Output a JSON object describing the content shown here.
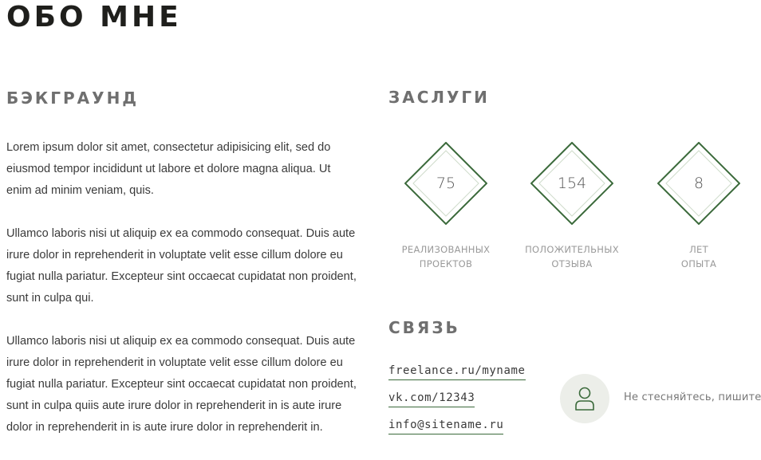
{
  "page": {
    "title": "ОБО МНЕ"
  },
  "background": {
    "title": "БЭКГРАУНД",
    "paragraphs": [
      "Lorem ipsum dolor sit amet, consectetur adipisicing elit, sed do eiusmod tempor incididunt ut labore et dolore magna aliqua. Ut enim ad minim veniam, quis.",
      "Ullamco laboris nisi ut aliquip ex ea commodo consequat. Duis aute irure dolor in reprehenderit in voluptate velit esse cillum dolore eu fugiat nulla pariatur. Excepteur sint occaecat cupidatat non proident, sunt in culpa qui.",
      "Ullamco laboris nisi ut aliquip ex ea commodo consequat. Duis aute irure dolor in reprehenderit in voluptate velit esse cillum dolore eu fugiat nulla pariatur. Excepteur sint occaecat cupidatat non proident, sunt in culpa quiis aute irure dolor in reprehenderit in is aute irure dolor in reprehenderit in is aute irure dolor in reprehenderit in."
    ]
  },
  "merits": {
    "title": "ЗАСЛУГИ",
    "stats": [
      {
        "value": "75",
        "label_line1": "РЕАЛИЗОВАННЫХ",
        "label_line2": "ПРОЕКТОВ"
      },
      {
        "value": "154",
        "label_line1": "ПОЛОЖИТЕЛЬНЫХ",
        "label_line2": "ОТЗЫВА"
      },
      {
        "value": "8",
        "label_line1": "ЛЕТ",
        "label_line2": "ОПЫТА"
      }
    ]
  },
  "contact": {
    "title": "СВЯЗЬ",
    "links": [
      "freelance.ru/myname",
      "vk.com/12343",
      "info@sitename.ru"
    ],
    "note": "Не стесняйтесь, пишите",
    "avatar_icon": "user-icon"
  },
  "colors": {
    "accent_green": "#3b6a3b",
    "accent_light": "#cfdccb",
    "heading_dark": "#1f1f1c",
    "heading_gray": "#6f6f6f",
    "avatar_bg": "#eceee9"
  }
}
